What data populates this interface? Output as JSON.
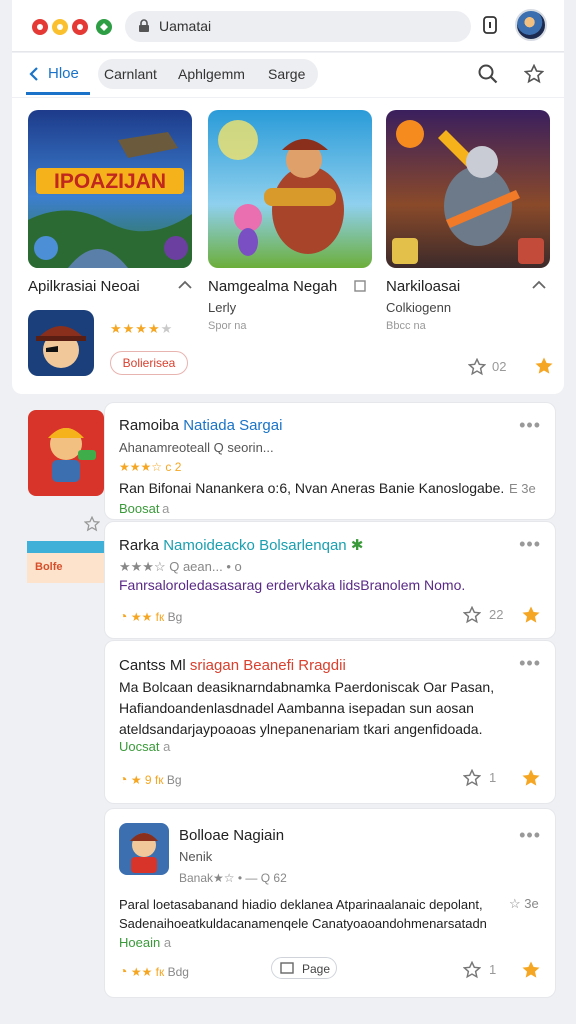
{
  "header": {
    "search_text": "Uamatai"
  },
  "tabs": {
    "home": "Hloe",
    "pills": [
      "Carnlant",
      "Aphlgemm",
      "Sarge"
    ]
  },
  "featured": {
    "items": [
      {
        "label": "Apilkrasiai Neoai",
        "banner": "IPOAZIJAN",
        "rating": 4
      },
      {
        "label": "Namgealma Negah",
        "sub": "Lerly",
        "sub2": "Spor na"
      },
      {
        "label": "Narkiloasai",
        "sub": "Colkiogenn",
        "sub2": "Bbcc na"
      }
    ],
    "badge": "Bolierisea",
    "count": "02"
  },
  "side": {
    "banner": "Bolfe"
  },
  "cards": [
    {
      "title_a": "Ramoiba ",
      "title_b": "Natiada Sargai",
      "meta": "Ahanamreoteall  Q seorin...",
      "rating_row": "★★★☆ c 2",
      "desc": "Ran Bifonai Nanankera o:6, Nvan Aneras Banie Kanoslogabe.",
      "desc_right": "E 3e",
      "tag": "Boosat ",
      "tag_extra": "a"
    },
    {
      "title_a": "Rarka ",
      "title_b": "Namoideacko Bolsarlenqan",
      "title_sym": "✱",
      "meta": "★★★☆  Q  aean... • o",
      "desc": "Fanrsaloroledasasarag erdervkaka lidsBranolem Nomo.",
      "foot": "Bg",
      "count": "22"
    },
    {
      "title_a": "Cantss Ml ",
      "title_b": "sriagan Beanefi Rragdii",
      "desc": "Ma Bolcaan deasiknarndabnamka Paerdoniscak Oar Pasan, Hafiandoandenlasdnadel Aambanna isepadan sun aosan ateldsandarjaypoaoas ylnepanenariam tkari angenfidoada.",
      "tag": "Uocsat",
      "tag_extra": "a",
      "foot": "Bg",
      "count": "1"
    },
    {
      "title": "Bolloae Nagiain",
      "meta": "Nenik",
      "rating_row": "Banak★☆ • — Q 62",
      "desc": "Paral loetasabanand hiadio deklanea Atparinaalanaic depolant, Sadenaihoeatkuldacanamenqele Canatyoaoandohmenarsatadn",
      "desc_right": "☆ 3e",
      "tag": "Hoeain",
      "tag_extra": "a",
      "foot": "Bdg",
      "page_btn": "Page",
      "count": "1"
    }
  ]
}
